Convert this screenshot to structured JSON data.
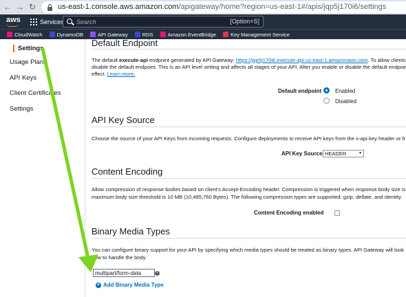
{
  "browser": {
    "url_host": "us-east-1.console.aws.amazon.com",
    "url_path": "/apigateway/home?region=us-east-1#/apis/jqp5j170i6/settings"
  },
  "aws_nav": {
    "logo": "aws",
    "services_label": "Services",
    "search_placeholder": "Search",
    "search_hotkey": "[Option+S]"
  },
  "favorites": [
    {
      "label": "CloudWatch",
      "color": "#e7157b"
    },
    {
      "label": "DynamoDB",
      "color": "#3b48cc"
    },
    {
      "label": "API Gateway",
      "color": "#8c4fff"
    },
    {
      "label": "RDS",
      "color": "#3b48cc"
    },
    {
      "label": "Amazon EventBridge",
      "color": "#e7157b"
    },
    {
      "label": "Key Management Service",
      "color": "#dd344c"
    }
  ],
  "sidebar": {
    "active_item": "Settings",
    "items": [
      "Usage Plans",
      "API Keys",
      "Client Certificates",
      "Settings"
    ]
  },
  "sections": {
    "default_endpoint": {
      "title": "Default Endpoint",
      "text_1a": "The default ",
      "text_1b": "execute-api",
      "text_1c": " endpoint generated by API Gateway: ",
      "link": "https://jqp5j170i6.execute-api.us-east-1.amazonaws.com",
      "text_1d": ". To allow clients",
      "text_2": "disable the default endpoint. This is an API level setting and affects all stages of your API. After you enable or disable the default endpoint",
      "text_3a": "effect. ",
      "learn_more": "Learn more.",
      "field_label": "Default endpoint",
      "option_enabled": "Enabled",
      "option_disabled": "Disabled"
    },
    "api_key_source": {
      "title": "API Key Source",
      "text": "Choose the source of your API Keys from incoming requests. Configure deployments to receive API keys from the x-api-key header or fr",
      "field_label": "API Key Source",
      "value": "HEADER"
    },
    "content_encoding": {
      "title": "Content Encoding",
      "text_1": "Allow compression of response bodies based on client's Accept-Encoding header. Compression is triggered when response body size is",
      "text_2": "maximum body size threshold is 10 MB (10,485,760 Bytes). The following compression types are supported: gzip, deflate, and identity.",
      "field_label": "Content Encoding enabled"
    },
    "binary_media_types": {
      "title": "Binary Media Types",
      "text_1": "You can configure binary support for your API by specifying which media types should be treated as binary types. API Gateway will look",
      "text_2": "how to handle the body.",
      "media_type_value": "multipart/form-data",
      "add_label": "Add Binary Media Type"
    }
  },
  "annotation_color": "#7ed321"
}
